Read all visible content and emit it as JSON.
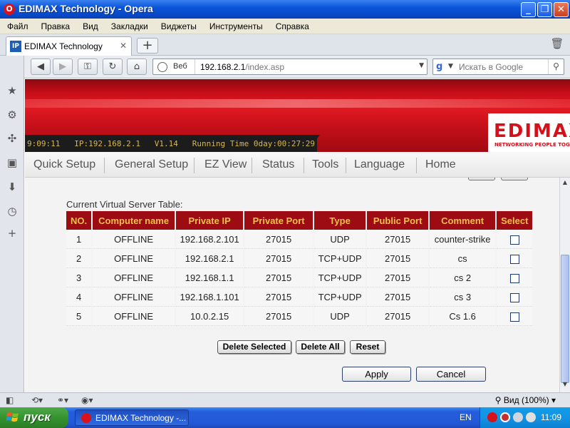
{
  "window": {
    "title": "EDIMAX Technology - Opera",
    "minimize_glyph": "_",
    "restore_glyph": "❐",
    "close_glyph": "✕"
  },
  "menubar": {
    "items": [
      "Файл",
      "Правка",
      "Вид",
      "Закладки",
      "Виджеты",
      "Инструменты",
      "Справка"
    ]
  },
  "tabs": {
    "active_tab_label": "EDIMAX Technology",
    "favicon_text": "IP",
    "close_glyph": "✕",
    "new_tab_glyph": "+"
  },
  "addressbar": {
    "badge": "Веб",
    "url_host": "192.168.2.1",
    "url_path": "/index.asp",
    "search_placeholder": "Искать в Google"
  },
  "router": {
    "status_line": "9:09:11   IP:192.168.2.1   V1.14   Running Time 0day:00:27:29",
    "brand": "EDIMAX",
    "tagline": "NETWORKING PEOPLE TOGETHER",
    "nav": [
      "Quick Setup",
      "General Setup",
      "EZ View",
      "Status",
      "Tools",
      "Language",
      "Home"
    ]
  },
  "virtual_server": {
    "caption": "Current Virtual Server Table:",
    "headers": [
      "NO.",
      "Computer name",
      "Private IP",
      "Private Port",
      "Type",
      "Public Port",
      "Comment",
      "Select"
    ],
    "rows": [
      {
        "no": "1",
        "computer": "OFFLINE",
        "private_ip": "192.168.2.101",
        "private_port": "27015",
        "type": "UDP",
        "public_port": "27015",
        "comment": "counter-strike",
        "selected": false
      },
      {
        "no": "2",
        "computer": "OFFLINE",
        "private_ip": "192.168.2.1",
        "private_port": "27015",
        "type": "TCP+UDP",
        "public_port": "27015",
        "comment": "cs",
        "selected": false
      },
      {
        "no": "3",
        "computer": "OFFLINE",
        "private_ip": "192.168.1.1",
        "private_port": "27015",
        "type": "TCP+UDP",
        "public_port": "27015",
        "comment": "cs 2",
        "selected": false
      },
      {
        "no": "4",
        "computer": "OFFLINE",
        "private_ip": "192.168.1.101",
        "private_port": "27015",
        "type": "TCP+UDP",
        "public_port": "27015",
        "comment": "cs 3",
        "selected": false
      },
      {
        "no": "5",
        "computer": "OFFLINE",
        "private_ip": "10.0.2.15",
        "private_port": "27015",
        "type": "UDP",
        "public_port": "27015",
        "comment": "Cs 1.6",
        "selected": false
      }
    ],
    "buttons": {
      "delete_selected": "Delete Selected",
      "delete_all": "Delete All",
      "reset": "Reset",
      "apply": "Apply",
      "cancel": "Cancel"
    }
  },
  "statusbar": {
    "zoom": "Вид (100%)"
  },
  "taskbar": {
    "start_label": "пуск",
    "task_item": "EDIMAX Technology -...",
    "lang": "EN",
    "clock": "11:09"
  },
  "colors": {
    "banner_red": "#e31b23",
    "header_cell_bg": "#9c0c12",
    "header_cell_text": "#f2c04a",
    "status_text": "#d7b84a",
    "xp_blue": "#245edc",
    "start_green": "#35942f"
  }
}
